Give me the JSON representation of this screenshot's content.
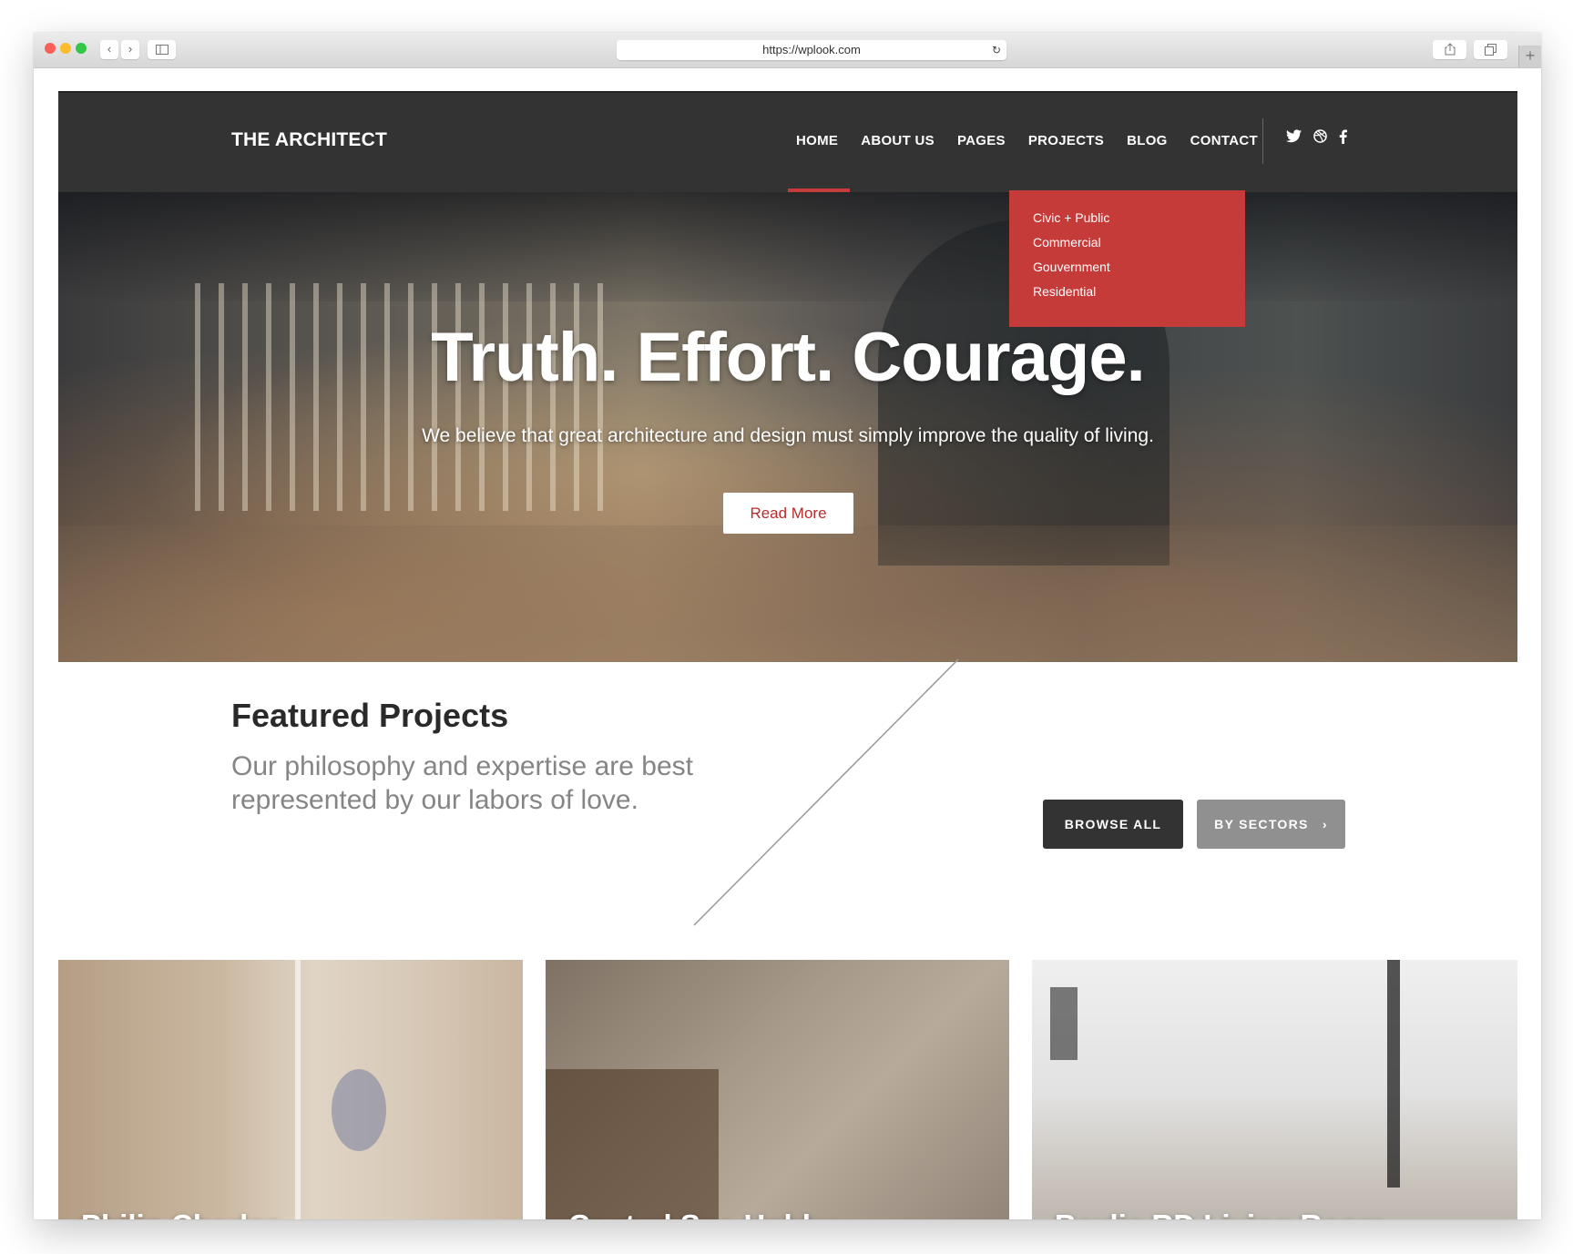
{
  "browser": {
    "url": "https://wplook.com",
    "back_icon": "‹",
    "forward_icon": "›",
    "reload_icon": "↻",
    "new_tab_icon": "+"
  },
  "site": {
    "logo": "THE ARCHITECT",
    "nav": [
      {
        "label": "HOME",
        "active": true
      },
      {
        "label": "ABOUT US",
        "active": false
      },
      {
        "label": "PAGES",
        "active": false
      },
      {
        "label": "PROJECTS",
        "active": false
      },
      {
        "label": "BLOG",
        "active": false
      },
      {
        "label": "CONTACT",
        "active": false
      }
    ],
    "socials": [
      "twitter",
      "dribbble",
      "facebook"
    ],
    "accent_color": "#c43b3a"
  },
  "dropdown": {
    "parent": "PROJECTS",
    "items": [
      "Civic + Public",
      "Commercial",
      "Gouvernment",
      "Residential"
    ]
  },
  "hero": {
    "title": "Truth. Effort. Courage.",
    "subtitle": "We believe that great architecture and design must simply improve the quality of living.",
    "cta": "Read More"
  },
  "featured": {
    "title": "Featured Projects",
    "description": "Our philosophy and expertise are best represented by our labors of love.",
    "browse_all": "BROWSE ALL",
    "by_sectors": "BY SECTORS",
    "by_sectors_icon": "›"
  },
  "projects": [
    {
      "title": "Philip Charles"
    },
    {
      "title": "Central Spa Hobby"
    },
    {
      "title": "Baylis RD Living Room"
    }
  ]
}
